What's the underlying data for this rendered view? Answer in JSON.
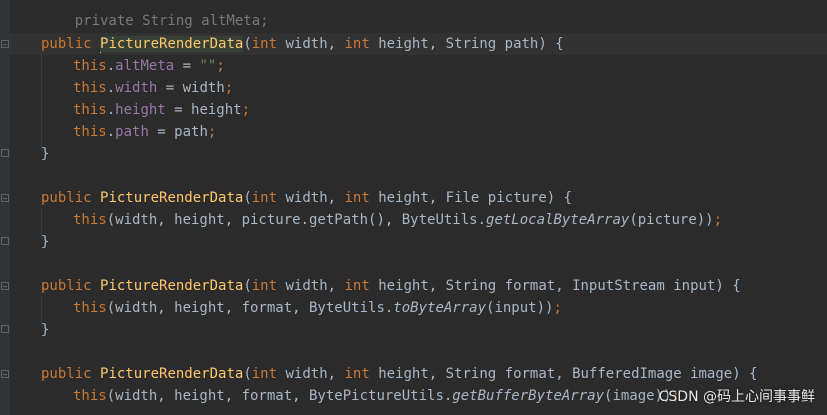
{
  "code": {
    "line0": "private String altMeta;",
    "l1": {
      "public": "public",
      "name": "PictureRenderData",
      "p1": "(",
      "int1": "int",
      "w": " width, ",
      "int2": "int",
      "rest": " height, String path) {"
    },
    "l2": {
      "this": "this",
      "dot": ".",
      "field": "altMeta",
      "eq": " = ",
      "str": "\"\"",
      "semi": ";"
    },
    "l3": {
      "this": "this",
      "dot": ".",
      "field": "width",
      "eq": " = width",
      "semi": ";"
    },
    "l4": {
      "this": "this",
      "dot": ".",
      "field": "height",
      "eq": " = height",
      "semi": ";"
    },
    "l5": {
      "this": "this",
      "dot": ".",
      "field": "path",
      "eq": " = path",
      "semi": ";"
    },
    "l6": "}",
    "l8": {
      "public": "public",
      "name": "PictureRenderData",
      "p1": "(",
      "int1": "int",
      "w": " width, ",
      "int2": "int",
      "rest": " height, File picture) {"
    },
    "l9": {
      "this": "this",
      "a": "(width, height, picture.getPath(), ByteUtils.",
      "method": "getLocalByteArray",
      "b": "(picture))",
      "semi": ";"
    },
    "l10": "}",
    "l12": {
      "public": "public",
      "name": "PictureRenderData",
      "p1": "(",
      "int1": "int",
      "w": " width, ",
      "int2": "int",
      "rest": " height, String format, InputStream input) {"
    },
    "l13": {
      "this": "this",
      "a": "(width, height, format, ByteUtils.",
      "method": "toByteArray",
      "b": "(input))",
      "semi": ";"
    },
    "l14": "}",
    "l16": {
      "public": "public",
      "name": "PictureRenderData",
      "p1": "(",
      "int1": "int",
      "w": " width, ",
      "int2": "int",
      "rest": " height, String format, BufferedImage image) {"
    },
    "l17": {
      "this": "this",
      "a": "(width, height, format, BytePictureUtils.",
      "method": "getBufferByteArray",
      "b": "(image))",
      "semi": ";"
    }
  },
  "watermark": "CSDN @码上心间事事鲜",
  "colors": {
    "background": "#2b2b2b",
    "keyword": "#cc7832",
    "field": "#9876aa",
    "method": "#ffc66d",
    "string": "#6a8759",
    "text": "#a9b7c6"
  }
}
